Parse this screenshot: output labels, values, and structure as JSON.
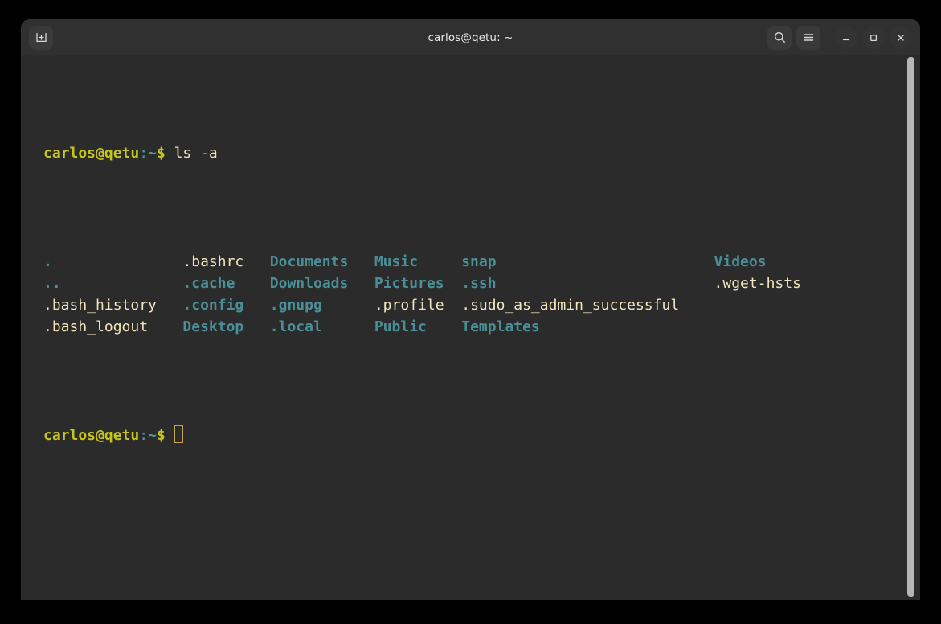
{
  "window": {
    "title": "carlos@qetu: ~"
  },
  "titlebar": {
    "new_tab_label": "",
    "new_tab_icon": "terminal-plus-icon",
    "search_icon": "search-icon",
    "menu_icon": "hamburger-menu-icon",
    "minimize_icon": "minimize-icon",
    "maximize_icon": "maximize-icon",
    "close_icon": "close-icon"
  },
  "terminal": {
    "prompt": {
      "user_host": "carlos@qetu",
      "colon": ":",
      "path": "~",
      "dollar": "$"
    },
    "command": " ls -a",
    "gap_col1": "",
    "rows": [
      {
        "cells": [
          {
            "text": ".",
            "kind": "dir"
          },
          {
            "text": ".bashrc",
            "kind": "file"
          },
          {
            "text": "Documents",
            "kind": "dir"
          },
          {
            "text": "Music",
            "kind": "dir"
          },
          {
            "text": "snap",
            "kind": "dir"
          },
          {
            "text": "Videos",
            "kind": "dir"
          }
        ]
      },
      {
        "cells": [
          {
            "text": "..",
            "kind": "dir"
          },
          {
            "text": ".cache",
            "kind": "dir"
          },
          {
            "text": "Downloads",
            "kind": "dir"
          },
          {
            "text": "Pictures",
            "kind": "dir"
          },
          {
            "text": ".ssh",
            "kind": "dir"
          },
          {
            "text": ".wget-hsts",
            "kind": "file"
          }
        ]
      },
      {
        "cells": [
          {
            "text": ".bash_history",
            "kind": "file"
          },
          {
            "text": ".config",
            "kind": "dir"
          },
          {
            "text": ".gnupg",
            "kind": "dir"
          },
          {
            "text": ".profile",
            "kind": "file"
          },
          {
            "text": ".sudo_as_admin_successful",
            "kind": "file"
          }
        ]
      },
      {
        "cells": [
          {
            "text": ".bash_logout",
            "kind": "file"
          },
          {
            "text": "Desktop",
            "kind": "dir"
          },
          {
            "text": ".local",
            "kind": "dir"
          },
          {
            "text": "Public",
            "kind": "dir"
          },
          {
            "text": "Templates",
            "kind": "dir"
          }
        ]
      }
    ],
    "column_starts": [
      0,
      16,
      26,
      38,
      48,
      77
    ],
    "colors": {
      "background": "#2b2b2b",
      "foreground": "#f2e5bc",
      "directory": "#4a8f96",
      "user_host": "#c5c520",
      "path": "#4a9ca6",
      "cursor": "#c5a54a"
    }
  },
  "scrollbar": {
    "name": "terminal-scrollbar"
  }
}
